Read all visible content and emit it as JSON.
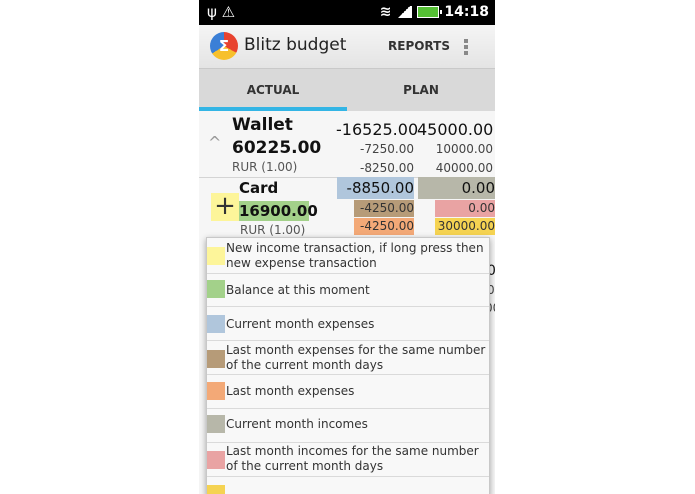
{
  "status_bar": {
    "time": "14:18"
  },
  "action_bar": {
    "title": "Blitz budget",
    "logo_glyph": "Σ",
    "reports_label": "REPORTS"
  },
  "tabs": [
    {
      "label": "ACTUAL",
      "active": true
    },
    {
      "label": "PLAN",
      "active": false
    }
  ],
  "accounts": [
    {
      "name": "Wallet",
      "balance": "60225.00",
      "currency": "RUR (1.00)",
      "values": {
        "actual_main": "-16525.00",
        "plan_main": "45000.00",
        "actual_sub1": "-7250.00",
        "plan_sub1": "10000.00",
        "actual_sub2": "-8250.00",
        "plan_sub2": "40000.00"
      }
    },
    {
      "name": "Card",
      "balance": "16900.00",
      "currency": "RUR (1.00)",
      "values": {
        "actual_main": "-8850.00",
        "plan_main": "0.00",
        "actual_sub1": "-4250.00",
        "plan_sub1": "0.00",
        "actual_sub2": "-4250.00",
        "plan_sub2": "30000.00"
      }
    }
  ],
  "third_row_fragments": [
    "0",
    "0",
    "00"
  ],
  "legend": [
    {
      "color": "#fdf59a",
      "text": "New income transaction, if long press then new expense transaction"
    },
    {
      "color": "#a3d18a",
      "text": "Balance at this moment"
    },
    {
      "color": "#b0c6dc",
      "text": "Current month expenses"
    },
    {
      "color": "#b69b78",
      "text": "Last month expenses for the same number of the current month days"
    },
    {
      "color": "#f3a977",
      "text": "Last month expenses"
    },
    {
      "color": "#b7b7a9",
      "text": "Current month incomes"
    },
    {
      "color": "#e9a3a3",
      "text": "Last month incomes for the same number of the current month days"
    }
  ]
}
